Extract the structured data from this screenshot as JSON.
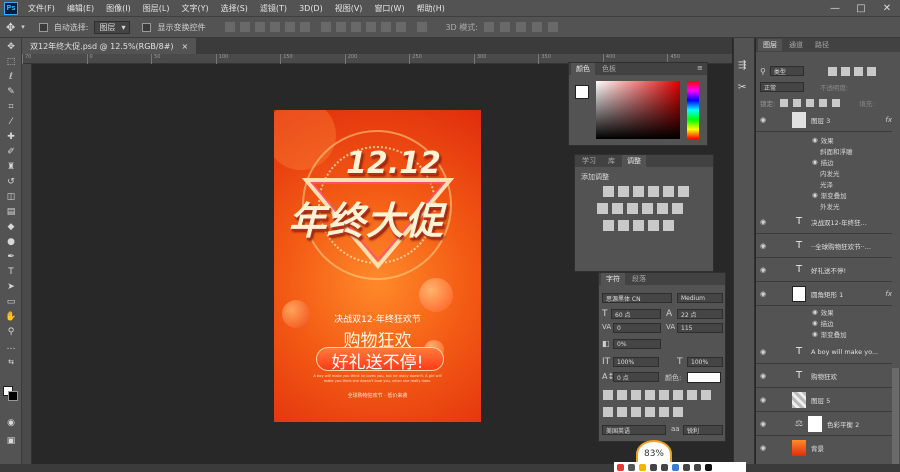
{
  "app": {
    "logo": "Ps"
  },
  "menu": [
    "文件(F)",
    "编辑(E)",
    "图像(I)",
    "图层(L)",
    "文字(Y)",
    "选择(S)",
    "滤镜(T)",
    "3D(D)",
    "视图(V)",
    "窗口(W)",
    "帮助(H)"
  ],
  "window_buttons": [
    "—",
    "□",
    "✕"
  ],
  "options_bar": {
    "auto_select_label": "自动选择:",
    "auto_select_value": "图层",
    "show_transform_label": "显示变换控件",
    "mode_3d_label": "3D 模式:"
  },
  "document_tab": {
    "title": "双12年终大促.psd @ 12.5%(RGB/8#)",
    "close": "×"
  },
  "ruler_ticks": [
    "70",
    "0",
    "50",
    "100",
    "150",
    "200",
    "250",
    "300",
    "350",
    "400",
    "450"
  ],
  "poster": {
    "headline_top": "12.12",
    "headline_main": "年终大促",
    "line1": "决战双12-年终狂欢节",
    "line2": "购物狂欢",
    "line3": "好礼送不停!",
    "small_en": "A boy will make you think he loves you, but he really doesn't. A girl will make you think she doesn't love you, when she really does.",
    "footer": "全球购物狂欢节 · 低价来袭"
  },
  "color_panel": {
    "tabs": [
      "颜色",
      "色板"
    ]
  },
  "adjust_panel": {
    "tabs": [
      "学习",
      "库",
      "调整"
    ],
    "heading": "添加调整"
  },
  "char_panel": {
    "tabs": [
      "字符",
      "段落"
    ],
    "font_family": "思源黑体 CN",
    "font_style": "Medium",
    "font_size": "60 点",
    "leading": "22 点",
    "kerning": "0",
    "tracking": "115",
    "vscale_pct": "0%",
    "hscale": "100%",
    "vscale": "100%",
    "baseline": "0 点",
    "color_label": "颜色:",
    "language": "美国英语",
    "aa_label": "aa",
    "aa_value": "锐利"
  },
  "layers_panel": {
    "tabs": [
      "图层",
      "通道",
      "路径"
    ],
    "kind_label": "类型",
    "blend_mode": "正常",
    "opacity_label": "不透明度:",
    "lock_label": "锁定:",
    "fill_label": "填充:",
    "layers": [
      {
        "name": "图层 3",
        "type": "image",
        "fx": "fx"
      },
      {
        "name": "决战双12-年终狂...",
        "type": "text"
      },
      {
        "name": "··全球购物狂欢节··...",
        "type": "text"
      },
      {
        "name": "好礼送不停!",
        "type": "text"
      },
      {
        "name": "圆角矩形 1",
        "type": "shape",
        "fx": "fx"
      },
      {
        "name": "A boy will make yo...",
        "type": "text"
      },
      {
        "name": "购物狂欢",
        "type": "text"
      },
      {
        "name": "图层 5",
        "type": "image"
      },
      {
        "name": "色彩平衡 2",
        "type": "adjust"
      },
      {
        "name": "背景",
        "type": "image"
      }
    ],
    "effects_a": [
      "效果",
      "斜面和浮雕",
      "描边",
      "内发光",
      "光泽",
      "渐变叠加",
      "外发光"
    ],
    "effects_b": [
      "效果",
      "描边",
      "渐变叠加"
    ]
  },
  "zoom_bubble": "83%",
  "colors": {
    "accent": "#31a8ff",
    "poster_red": "#e02c0d",
    "poster_orange": "#ff8a2a"
  }
}
